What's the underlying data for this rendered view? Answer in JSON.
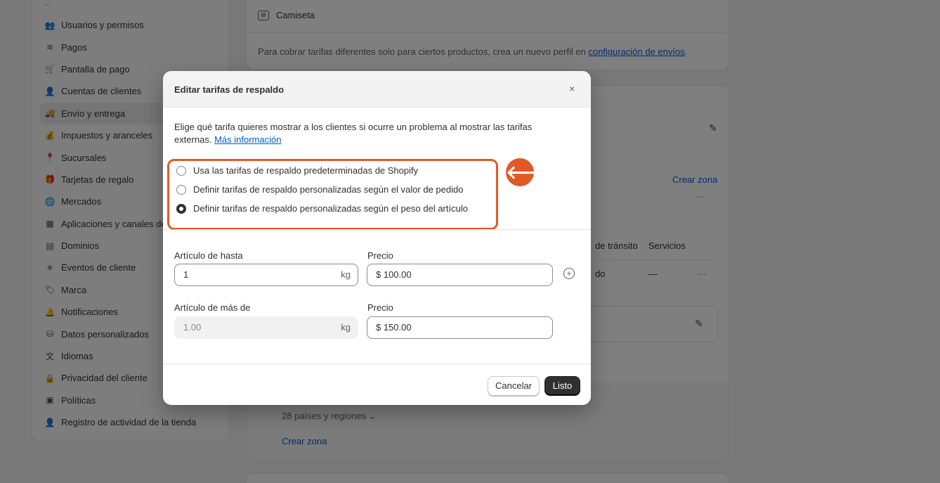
{
  "sidebar": {
    "overflow_indicator": "...",
    "items": [
      {
        "label": "Usuarios y permisos",
        "icon": "users-icon",
        "glyph": "👥"
      },
      {
        "label": "Pagos",
        "icon": "payments-icon",
        "glyph": "≋"
      },
      {
        "label": "Pantalla de pago",
        "icon": "cart-icon",
        "glyph": "🛒"
      },
      {
        "label": "Cuentas de clientes",
        "icon": "person-icon",
        "glyph": "👤"
      },
      {
        "label": "Envío y entrega",
        "icon": "truck-icon",
        "glyph": "🚚"
      },
      {
        "label": "Impuestos y aranceles",
        "icon": "tax-icon",
        "glyph": "💰"
      },
      {
        "label": "Sucursales",
        "icon": "location-icon",
        "glyph": "📍"
      },
      {
        "label": "Tarjetas de regalo",
        "icon": "gift-card-icon",
        "glyph": "🎁"
      },
      {
        "label": "Mercados",
        "icon": "globe-icon",
        "glyph": "🌐"
      },
      {
        "label": "Aplicaciones y canales de venta",
        "icon": "apps-icon",
        "glyph": "▦"
      },
      {
        "label": "Dominios",
        "icon": "domain-icon",
        "glyph": "▤"
      },
      {
        "label": "Eventos de cliente",
        "icon": "sparkle-icon",
        "glyph": "✳"
      },
      {
        "label": "Marca",
        "icon": "brand-icon",
        "glyph": "🏷"
      },
      {
        "label": "Notificaciones",
        "icon": "bell-icon",
        "glyph": "🔔"
      },
      {
        "label": "Datos personalizados",
        "icon": "database-icon",
        "glyph": "⛁"
      },
      {
        "label": "Idiomas",
        "icon": "language-icon",
        "glyph": "文"
      },
      {
        "label": "Privacidad del cliente",
        "icon": "lock-icon",
        "glyph": "🔒"
      },
      {
        "label": "Políticas",
        "icon": "policy-icon",
        "glyph": "▣"
      },
      {
        "label": "Registro de actividad de la tienda",
        "icon": "activity-icon",
        "glyph": "👤"
      }
    ],
    "active_index": 4
  },
  "background": {
    "product_name": "Camiseta",
    "note_text": "Para cobrar tarifas diferentes solo para ciertos productos, crea un nuevo perfil en ",
    "note_link": "configuración de envíos",
    "note_end": ".",
    "crear_zona": "Crear zona",
    "more": "···",
    "col_transit": "de tránsito",
    "col_services": "Servicios",
    "cell_transit": "do",
    "cell_services": "—",
    "countries": "28 países y regiones ⌄",
    "crear_zona_2": "Crear zona"
  },
  "modal": {
    "title": "Editar tarifas de respaldo",
    "close": "×",
    "description": "Elige qué tarifa quieres mostrar a los clientes si ocurre un problema al mostrar las tarifas externas. ",
    "more_info": "Más información",
    "options": [
      {
        "label": "Usa las tarifas de respaldo predeterminadas de Shopify",
        "checked": false
      },
      {
        "label": "Definir tarifas de respaldo personalizadas según el valor de pedido",
        "checked": false
      },
      {
        "label": "Definir tarifas de respaldo personalizadas según el peso del artículo",
        "checked": true
      }
    ],
    "arrow": "🡐",
    "row1": {
      "weight_label": "Artículo de hasta",
      "weight_value": "1",
      "unit": "kg",
      "price_label": "Precio",
      "price_value": "$ 100.00"
    },
    "row2": {
      "weight_label": "Artículo de más de",
      "weight_value": "1.00",
      "unit": "kg",
      "price_label": "Precio",
      "price_value": "$ 150.00"
    },
    "add": "+",
    "cancel": "Cancelar",
    "done": "Listo"
  },
  "colors": {
    "highlight": "#e15a26",
    "link": "#005bd3",
    "primary": "#303030"
  }
}
